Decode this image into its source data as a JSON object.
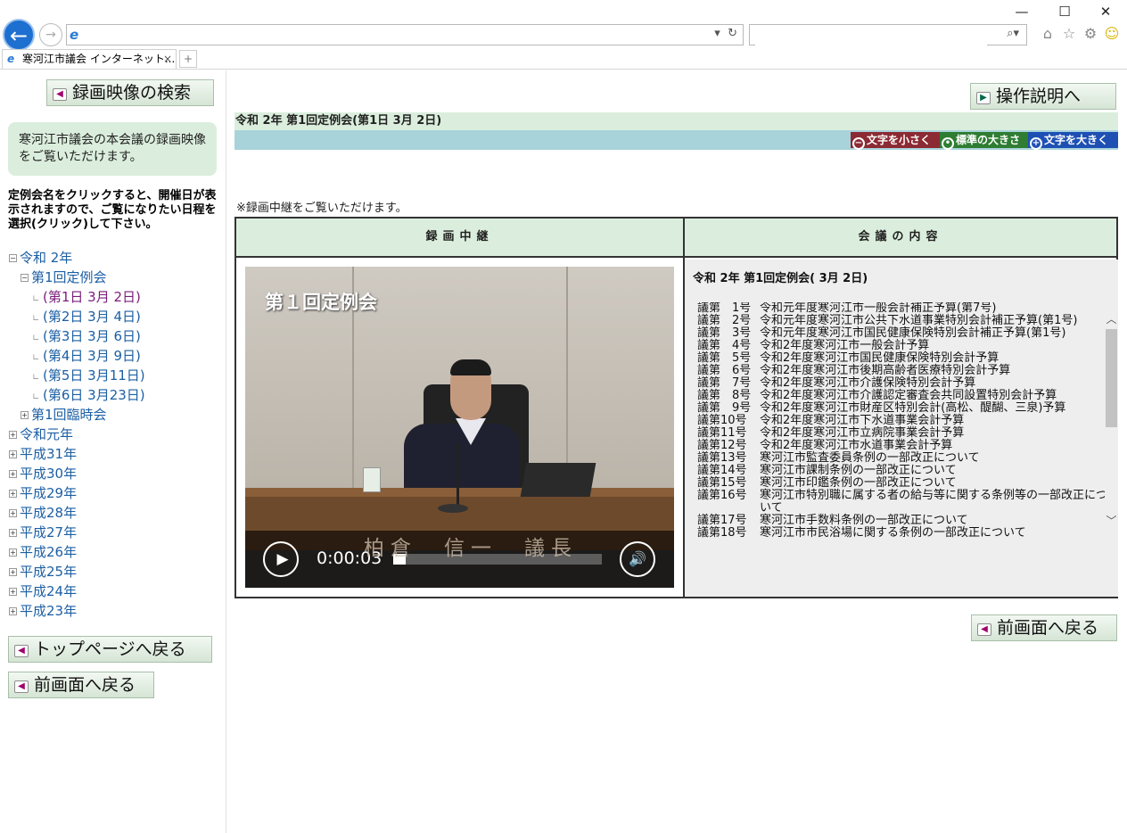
{
  "browser": {
    "tab_title": "寒河江市議会 インターネット...",
    "tab_close": "×",
    "address_value": "",
    "search_value": "",
    "window_controls": [
      "—",
      "☐",
      "✕"
    ],
    "icons": [
      "back-arrow-icon",
      "forward-arrow-icon",
      "ie-logo-icon",
      "refresh-icon",
      "search-icon",
      "home-icon",
      "favorites-star-icon",
      "settings-gear-icon",
      "smiley-feedback-icon"
    ]
  },
  "left": {
    "search_button": "録画映像の検索",
    "info_text": "寒河江市議会の本会議の録画映像をご覧いただけます。",
    "notice": "定例会名をクリックすると、開催日が表示されますので、ご覧になりたい日程を選択(クリック)して下さい。",
    "tree": [
      {
        "level": 0,
        "toggle": "−",
        "label": "令和 2年"
      },
      {
        "level": 1,
        "toggle": "−",
        "label": "第1回定例会"
      },
      {
        "level": 2,
        "toggle": "leaf",
        "label": "(第1日 3月 2日)",
        "active": true
      },
      {
        "level": 2,
        "toggle": "leaf",
        "label": "(第2日 3月 4日)"
      },
      {
        "level": 2,
        "toggle": "leaf",
        "label": "(第3日 3月 6日)"
      },
      {
        "level": 2,
        "toggle": "leaf",
        "label": "(第4日 3月 9日)"
      },
      {
        "level": 2,
        "toggle": "leaf",
        "label": "(第5日 3月11日)"
      },
      {
        "level": 2,
        "toggle": "leaf",
        "label": "(第6日 3月23日)"
      },
      {
        "level": 1,
        "toggle": "+",
        "label": "第1回臨時会"
      },
      {
        "level": 0,
        "toggle": "+",
        "label": "令和元年"
      },
      {
        "level": 0,
        "toggle": "+",
        "label": "平成31年"
      },
      {
        "level": 0,
        "toggle": "+",
        "label": "平成30年"
      },
      {
        "level": 0,
        "toggle": "+",
        "label": "平成29年"
      },
      {
        "level": 0,
        "toggle": "+",
        "label": "平成28年"
      },
      {
        "level": 0,
        "toggle": "+",
        "label": "平成27年"
      },
      {
        "level": 0,
        "toggle": "+",
        "label": "平成26年"
      },
      {
        "level": 0,
        "toggle": "+",
        "label": "平成25年"
      },
      {
        "level": 0,
        "toggle": "+",
        "label": "平成24年"
      },
      {
        "level": 0,
        "toggle": "+",
        "label": "平成23年"
      }
    ],
    "top_page_button": "トップページへ戻る",
    "back_button": "前画面へ戻る"
  },
  "right": {
    "help_button": "操作説明へ",
    "session_header": "令和 2年 第1回定例会(第1日 3月 2日)",
    "font_small": "文字を小さく",
    "font_normal": "標準の大きさ",
    "font_large": "文字を大きく",
    "note": "※録画中継をご覧いただけます。",
    "col_video": "録画中継",
    "col_content": "会議の内容",
    "video": {
      "caption": "第１回定例会",
      "speaker_name": "柏倉　信一　議長",
      "time": "0:00:03",
      "progress": 0.06
    },
    "content_title": "令和 2年 第1回定例会( 3月 2日)",
    "agenda": [
      {
        "no": "議第　1号",
        "text": "令和元年度寒河江市一般会計補正予算(第7号)"
      },
      {
        "no": "議第　2号",
        "text": "令和元年度寒河江市公共下水道事業特別会計補正予算(第1号)"
      },
      {
        "no": "議第　3号",
        "text": "令和元年度寒河江市国民健康保険特別会計補正予算(第1号)"
      },
      {
        "no": "議第　4号",
        "text": "令和2年度寒河江市一般会計予算"
      },
      {
        "no": "議第　5号",
        "text": "令和2年度寒河江市国民健康保険特別会計予算"
      },
      {
        "no": "議第　6号",
        "text": "令和2年度寒河江市後期高齢者医療特別会計予算"
      },
      {
        "no": "議第　7号",
        "text": "令和2年度寒河江市介護保険特別会計予算"
      },
      {
        "no": "議第　8号",
        "text": "令和2年度寒河江市介護認定審査会共同設置特別会計予算"
      },
      {
        "no": "議第　9号",
        "text": "令和2年度寒河江市財産区特別会計(高松、醍醐、三泉)予算"
      },
      {
        "no": "議第10号",
        "text": "令和2年度寒河江市下水道事業会計予算"
      },
      {
        "no": "議第11号",
        "text": "令和2年度寒河江市立病院事業会計予算"
      },
      {
        "no": "議第12号",
        "text": "令和2年度寒河江市水道事業会計予算"
      },
      {
        "no": "議第13号",
        "text": "寒河江市監査委員条例の一部改正について"
      },
      {
        "no": "議第14号",
        "text": "寒河江市課制条例の一部改正について"
      },
      {
        "no": "議第15号",
        "text": "寒河江市印鑑条例の一部改正について"
      },
      {
        "no": "議第16号",
        "text": "寒河江市特別職に属する者の給与等に関する条例等の一部改正について"
      },
      {
        "no": "議第17号",
        "text": "寒河江市手数料条例の一部改正について"
      },
      {
        "no": "議第18号",
        "text": "寒河江市市民浴場に関する条例の一部改正について"
      }
    ],
    "back_button": "前画面へ戻る"
  },
  "colors": {
    "green_bg": "#dbeedd",
    "teal_bar": "#a9d3da",
    "font_small_bg": "#8c2a34",
    "font_normal_bg": "#2e7d32",
    "font_large_bg": "#1e50b4",
    "link": "#1c5fa3",
    "visited": "#7a1d7a"
  }
}
